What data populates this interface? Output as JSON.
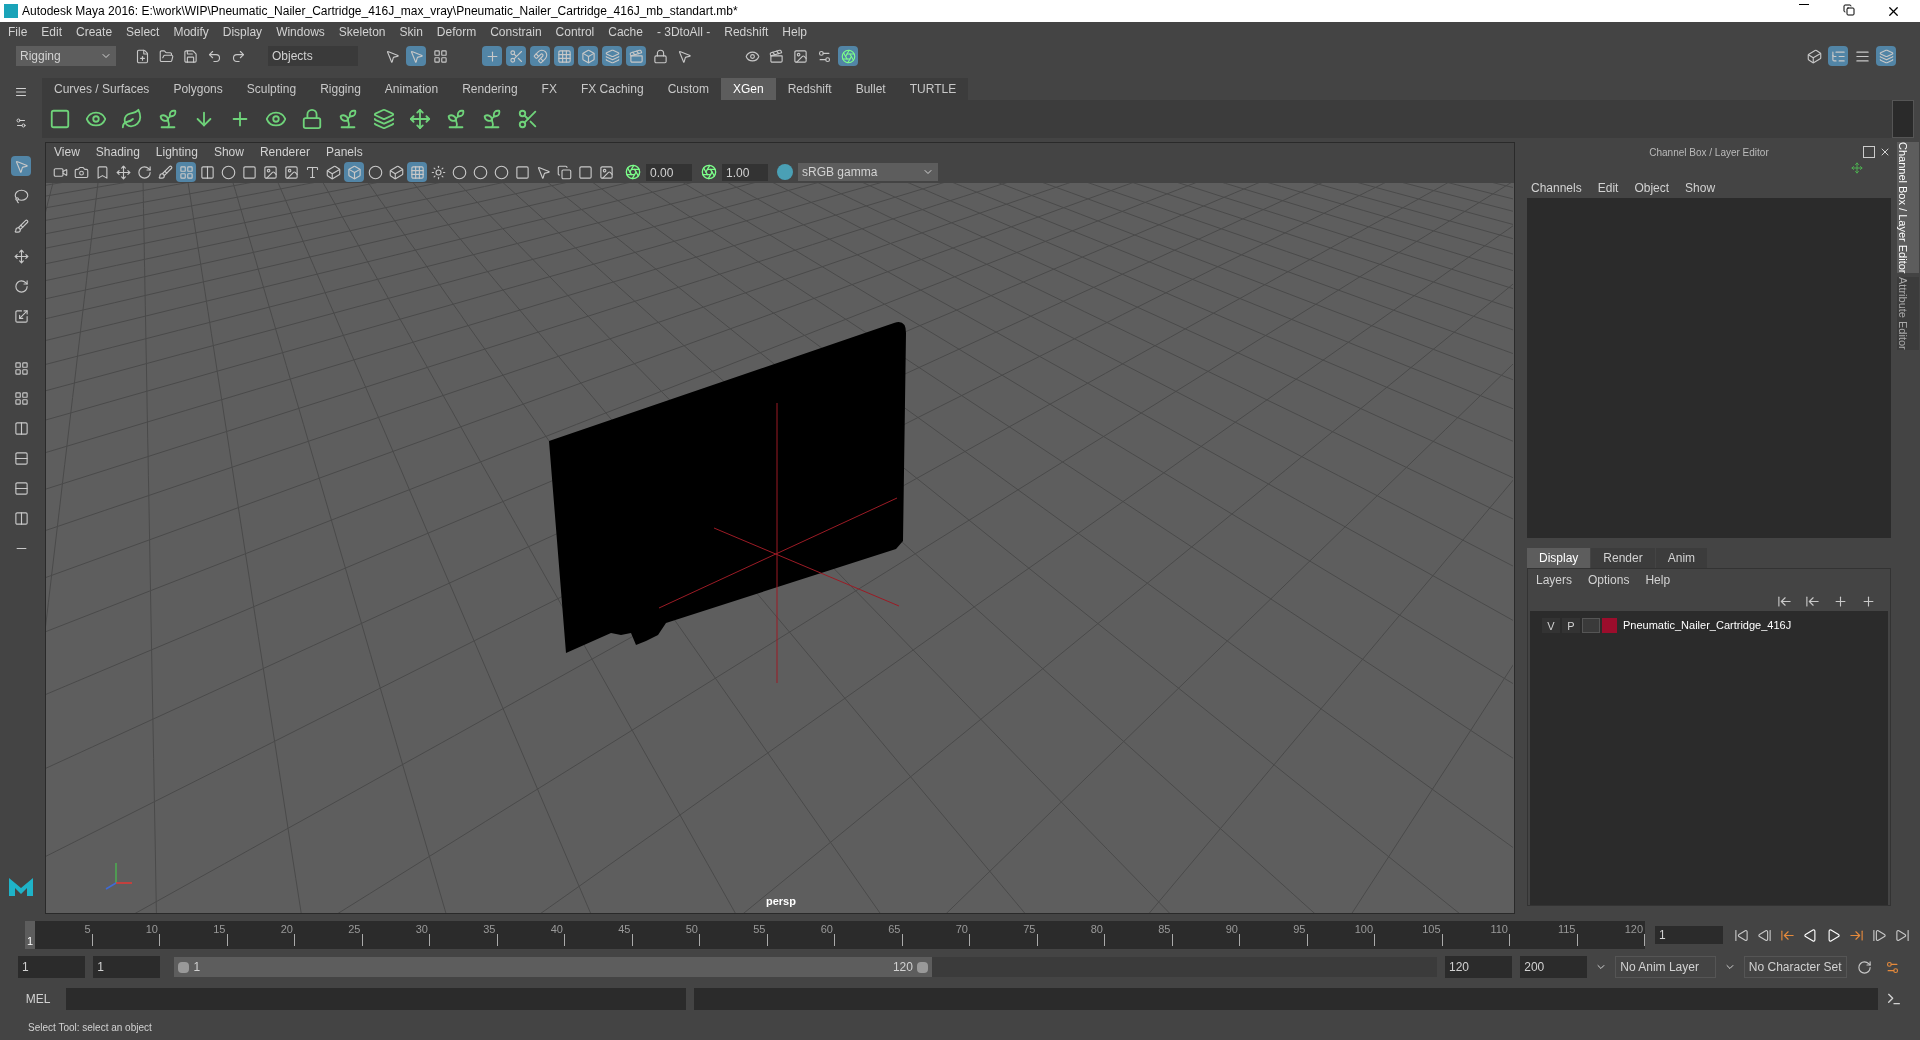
{
  "window": {
    "title": "Autodesk Maya 2016: E:\\work\\WIP\\Pneumatic_Nailer_Cartridge_416J_max_vray\\Pneumatic_Nailer_Cartridge_416J_mb_standart.mb*"
  },
  "menu_bar": [
    "File",
    "Edit",
    "Create",
    "Select",
    "Modify",
    "Display",
    "Windows",
    "Skeleton",
    "Skin",
    "Deform",
    "Constrain",
    "Control",
    "Cache",
    "- 3DtoAll -",
    "Redshift",
    "Help"
  ],
  "status_line": {
    "menu_set": "Rigging",
    "selection_field": "Objects"
  },
  "shelf_tabs": [
    {
      "label": "Curves / Surfaces",
      "selected": false
    },
    {
      "label": "Polygons",
      "selected": false
    },
    {
      "label": "Sculpting",
      "selected": false
    },
    {
      "label": "Rigging",
      "selected": false
    },
    {
      "label": "Animation",
      "selected": false
    },
    {
      "label": "Rendering",
      "selected": false
    },
    {
      "label": "FX",
      "selected": false
    },
    {
      "label": "FX Caching",
      "selected": false
    },
    {
      "label": "Custom",
      "selected": false
    },
    {
      "label": "XGen",
      "selected": true
    },
    {
      "label": "Redshift",
      "selected": false
    },
    {
      "label": "Bullet",
      "selected": false
    },
    {
      "label": "TURTLE",
      "selected": false
    }
  ],
  "viewport": {
    "menu": [
      "View",
      "Shading",
      "Lighting",
      "Show",
      "Renderer",
      "Panels"
    ],
    "exposure": "0.00",
    "gamma": "1.00",
    "color_space": "sRGB gamma",
    "camera_label": "persp"
  },
  "channel_box": {
    "title": "Channel Box / Layer Editor",
    "menu": [
      "Channels",
      "Edit",
      "Object",
      "Show"
    ]
  },
  "layer_editor": {
    "tabs": [
      {
        "label": "Display",
        "selected": true
      },
      {
        "label": "Render",
        "selected": false
      },
      {
        "label": "Anim",
        "selected": false
      }
    ],
    "menu": [
      "Layers",
      "Options",
      "Help"
    ],
    "layers": [
      {
        "visibility": "V",
        "playback": "P",
        "color": "#9b0d2c",
        "name": "Pneumatic_Nailer_Cartridge_416J"
      }
    ]
  },
  "side_tabs": [
    {
      "label": "Channel Box / Layer Editor",
      "selected": true
    },
    {
      "label": "Attribute Editor",
      "selected": false
    }
  ],
  "time_slider": {
    "ticks": [
      "5",
      "10",
      "15",
      "20",
      "25",
      "30",
      "35",
      "40",
      "45",
      "50",
      "55",
      "60",
      "65",
      "70",
      "75",
      "80",
      "85",
      "90",
      "95",
      "100",
      "105",
      "110",
      "115",
      "120"
    ],
    "current_frame_marker": "1",
    "current_frame": "1"
  },
  "range_slider": {
    "level": 0.6,
    "start": "1",
    "playback_start": "1",
    "range_start": "1",
    "range_end": "120",
    "playback_end": "120",
    "end": "200",
    "anim_layer": "No Anim Layer",
    "character_set": "No Character Set"
  },
  "command_line": {
    "label": "MEL"
  },
  "help_line": "Select Tool: select an object"
}
